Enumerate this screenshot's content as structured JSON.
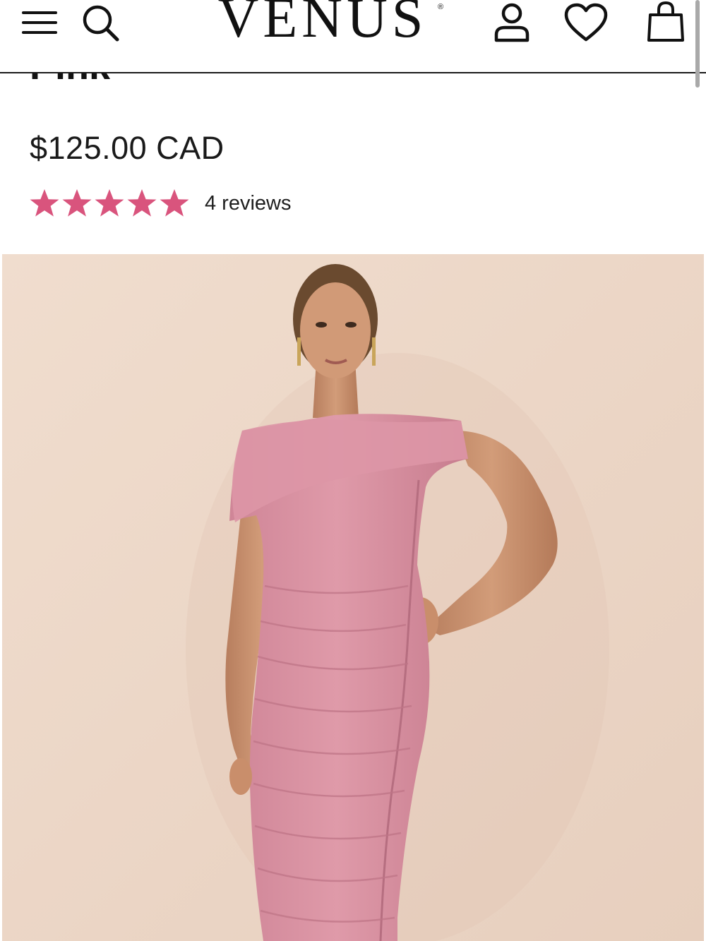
{
  "header": {
    "logo_text": "VENUS",
    "logo_reg": "®",
    "icons": [
      "menu-icon",
      "search-icon",
      "account-icon",
      "heart-icon",
      "shopping-bag-icon"
    ]
  },
  "product": {
    "title_partial": "Pink",
    "price": "$125.00 CAD",
    "rating": {
      "stars": 5,
      "max": 5
    },
    "reviews_label": "4 reviews",
    "image_alt": "Model wearing pink one-shoulder ruched mesh dress"
  },
  "colors": {
    "star": "#d9547d",
    "dress": "#d88f9e",
    "background": "#efdbcc",
    "text": "#1a1a1a"
  }
}
